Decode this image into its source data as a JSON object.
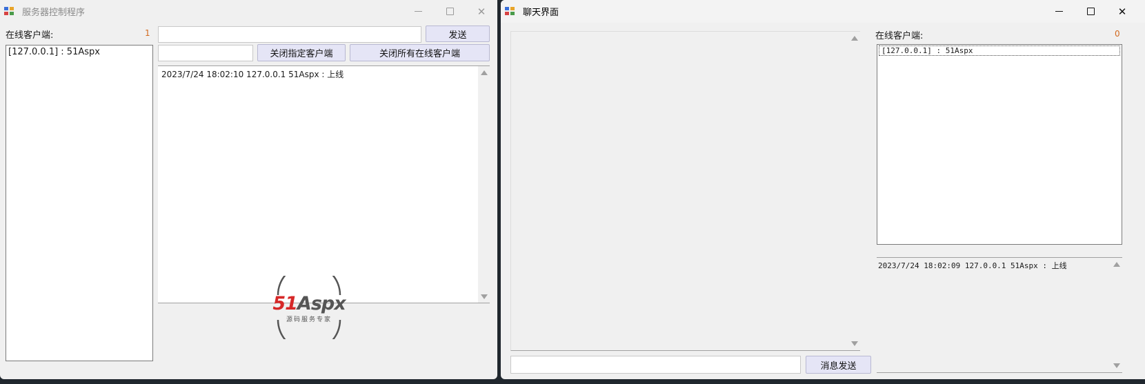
{
  "server": {
    "title": "服务器控制程序",
    "online_label": "在线客户端:",
    "online_count": "1",
    "clients": [
      "[127.0.0.1] : 51Aspx"
    ],
    "send_label": "发送",
    "close_selected_label": "关闭指定客户端",
    "close_all_label": "关闭所有在线客户端",
    "log": [
      "2023/7/24 18:02:10 127.0.0.1 51Aspx : 上线"
    ],
    "message_value": "",
    "client_name_value": ""
  },
  "chat": {
    "title": "聊天界面",
    "online_label": "在线客户端:",
    "online_count": "0",
    "clients": [
      "[127.0.0.1] : 51Aspx"
    ],
    "log": [
      "2023/7/24 18:02:09 127.0.0.1 51Aspx : 上线"
    ],
    "send_label": "消息发送",
    "message_value": ""
  },
  "watermark": {
    "brand_51": "51",
    "brand_aspx": "Aspx",
    "tagline": "源码服务专家",
    "colors": {
      "red": "#d62828",
      "gray": "#555555",
      "green": "#3a9b3a"
    }
  },
  "icons": [
    "app-icon",
    "minimize-icon",
    "maximize-icon",
    "close-icon",
    "scroll-up-icon",
    "scroll-down-icon"
  ]
}
